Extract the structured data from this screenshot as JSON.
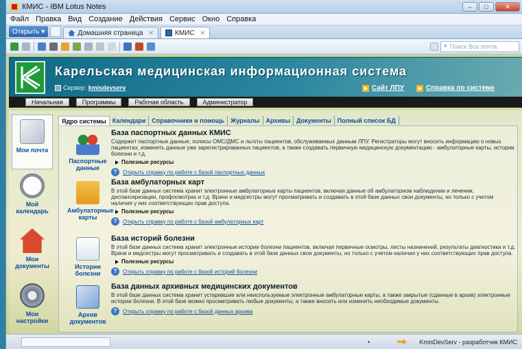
{
  "window": {
    "title": "КМИС - IBM Lotus Notes"
  },
  "menu": [
    {
      "label": "Файл"
    },
    {
      "label": "Правка"
    },
    {
      "label": "Вид"
    },
    {
      "label": "Создание"
    },
    {
      "label": "Действия"
    },
    {
      "label": "Сервис"
    },
    {
      "label": "Окно"
    },
    {
      "label": "Справка"
    }
  ],
  "tabs": {
    "open_label": "Открыть",
    "home_label": "Домашняя страница",
    "kmis_label": "КМИС"
  },
  "search": {
    "placeholder": "Поиск Все почта"
  },
  "header": {
    "title": "Карельская медицинская информационная система",
    "server_label": "Сервер:",
    "server_name": "kmisdevserv",
    "link_site": "Сайт ЛПУ",
    "link_help": "Справка по системе"
  },
  "nav": [
    {
      "label": "Начальная"
    },
    {
      "label": "Программы"
    },
    {
      "label": "Рабочая область"
    },
    {
      "label": "Администратор"
    }
  ],
  "left_nav": [
    {
      "label": "Мои почта"
    },
    {
      "label": "Мой календарь"
    },
    {
      "label": "Мои документы"
    },
    {
      "label": "Мои настройки"
    }
  ],
  "section_tabs": [
    {
      "label": "Ядро системы"
    },
    {
      "label": "Календари"
    },
    {
      "label": "Справочники и помощь"
    },
    {
      "label": "Журналы"
    },
    {
      "label": "Архивы"
    },
    {
      "label": "Документы"
    },
    {
      "label": "Полный список БД"
    }
  ],
  "databases": [
    {
      "icon_label": "Паспортные данные",
      "title": "База паспортных данных КМИС",
      "desc": "Содержит паспортные данные, полисы ОМС/ДМС и льготы пациентов, обслуживаемых данным ЛПУ. Регистраторы могут вносить информацию о новых пациентах, изменять данные уже зарегистрированных пациентов, а также создавать первичную медицинскую документацию - амбулаторные карты, истории болезни и т.д.",
      "resources": "Полезные ресурсы",
      "help": "Открыть справку по работе с базой паспортных данных"
    },
    {
      "icon_label": "Амбулаторные карты",
      "title": "База амбулаторных карт",
      "desc": "В этой базе данных система хранит электронные амбулаторные карты пациентов, включая данные об амбулаторном наблюдении и лечении, диспансеризации, профосмотрах и т.д. Врачи и медсестры могут просматривать и создавать в этой базе данных свои документы, но только с учетом наличия у них соответствующих прав доступа.",
      "resources": "Полезные ресурсы",
      "help": "Открыть справку по работе с базой амбулаторных карт"
    },
    {
      "icon_label": "Истории болезни",
      "title": "База историй болезни",
      "desc": "В этой базе данных система хранит электронные истории болезни пациентов, включая первичные осмотры, листы назначений, результаты диагностики и т.д. Врачи и медсестры могут просматривать и создавать в этой базе данных свои документы, но только с учетом наличия у них соответствующих прав доступа.",
      "resources": "Полезные ресурсы",
      "help": "Открыть справку по работе с базой историй болезни"
    },
    {
      "icon_label": "Архив документов",
      "title": "База данных архивных медицинских документов",
      "desc": "В этой базе данных система хранит устаревшие или неиспользуемые электронные амбулаторные карты, а также закрытые (сданные в архив) электронные истории болезни. В этой базе можно просматривать любые документы, а также вносить или изменять необходимые документы.",
      "resources": "",
      "help": "Открыть справку по работе с базой данных архива"
    }
  ],
  "status": {
    "text": "KmisDevServ - разработчик КМИС"
  }
}
